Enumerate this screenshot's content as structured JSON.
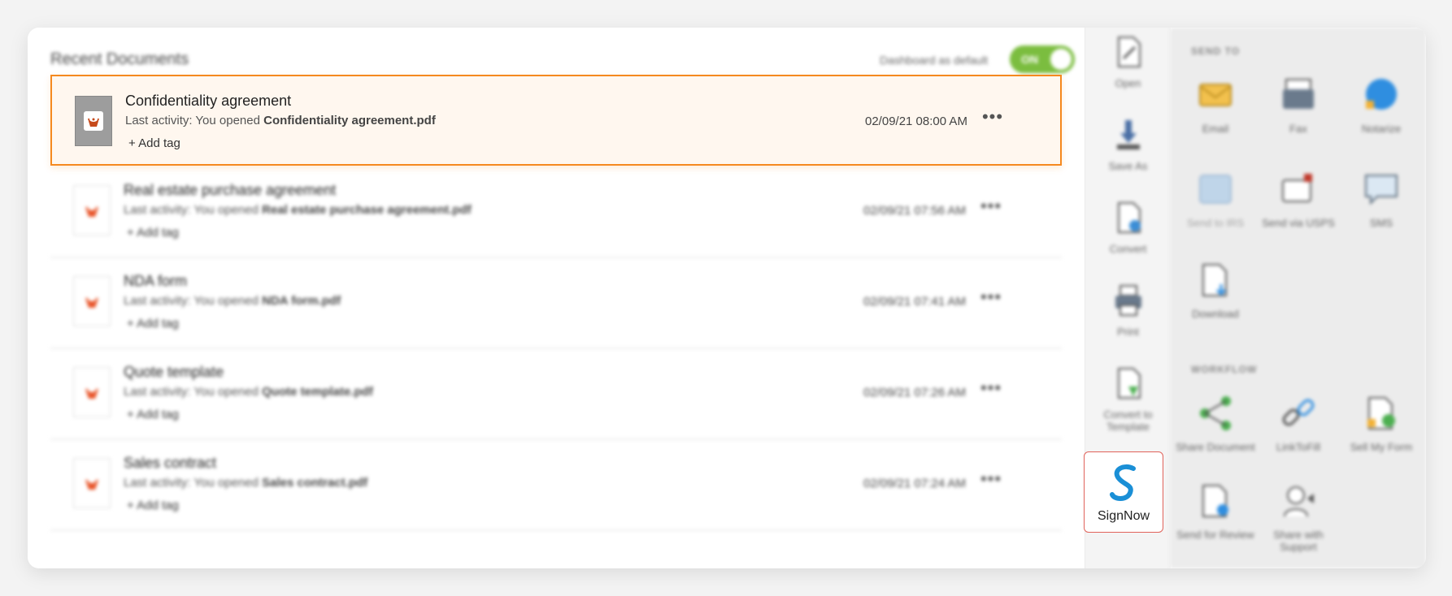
{
  "header": {
    "title": "Recent Documents",
    "dashboard_label": "Dashboard as default",
    "toggle_label": "ON"
  },
  "documents": [
    {
      "name": "Confidentiality agreement",
      "activity_prefix": "Last activity: You opened",
      "file": "Confidentiality agreement.pdf",
      "add_tag": "+ Add tag",
      "date": "02/09/21 08:00 AM",
      "more": "•••"
    },
    {
      "name": "Real estate purchase agreement",
      "activity_prefix": "Last activity: You opened",
      "file": "Real estate purchase agreement.pdf",
      "add_tag": "+ Add tag",
      "date": "02/09/21 07:56 AM",
      "more": "•••"
    },
    {
      "name": "NDA form",
      "activity_prefix": "Last activity: You opened",
      "file": "NDA form.pdf",
      "add_tag": "+ Add tag",
      "date": "02/09/21 07:41 AM",
      "more": "•••"
    },
    {
      "name": "Quote template",
      "activity_prefix": "Last activity: You opened",
      "file": "Quote template.pdf",
      "add_tag": "+ Add tag",
      "date": "02/09/21 07:26 AM",
      "more": "•••"
    },
    {
      "name": "Sales contract",
      "activity_prefix": "Last activity: You opened",
      "file": "Sales contract.pdf",
      "add_tag": "+ Add tag",
      "date": "02/09/21 07:24 AM",
      "more": "•••"
    }
  ],
  "actions": {
    "open": "Open",
    "save_as": "Save As",
    "convert": "Convert",
    "print": "Print",
    "convert_to_template": "Convert to Template",
    "signnow": "SignNow"
  },
  "send_to": {
    "title": "SEND TO",
    "items": {
      "email": "Email",
      "fax": "Fax",
      "notarize": "Notarize",
      "send_irs": "Send to IRS",
      "send_usps": "Send via USPS",
      "sms": "SMS",
      "download": "Download"
    }
  },
  "workflow": {
    "title": "WORKFLOW",
    "items": {
      "share_document": "Share Document",
      "linktofill": "LinkToFill",
      "sell_form": "Sell My Form",
      "send_review": "Send for Review",
      "share_support": "Share with Support"
    }
  },
  "colors": {
    "accent_orange": "#f5891f",
    "toggle_green": "#7bbd3f",
    "signnow_blue": "#1a8fd6",
    "signnow_border": "#e0625a"
  }
}
